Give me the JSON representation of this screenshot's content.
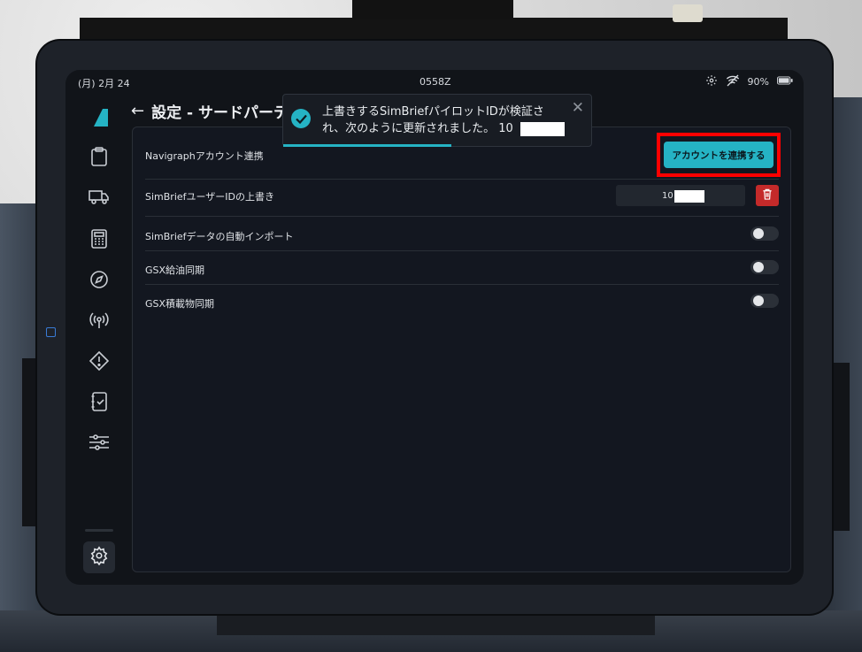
{
  "status_bar": {
    "date": "(月) 2月 24",
    "clock": "0558Z",
    "battery": "90%",
    "icons": [
      "gear-icon",
      "wifi-off-icon",
      "battery-icon"
    ]
  },
  "sidebar": {
    "items": [
      {
        "name": "clipboard-icon"
      },
      {
        "name": "truck-icon"
      },
      {
        "name": "calculator-icon"
      },
      {
        "name": "compass-icon"
      },
      {
        "name": "radio-icon"
      },
      {
        "name": "warning-icon"
      },
      {
        "name": "checklist-icon"
      },
      {
        "name": "sliders-icon"
      }
    ],
    "settings_icon": "gear-icon"
  },
  "header": {
    "back_icon": "←",
    "title": "設定 - サードパーテ"
  },
  "settings": {
    "navigraph": {
      "label": "Navigraphアカウント連携",
      "button_label": "アカウントを連携する"
    },
    "simbrief_override": {
      "label": "SimBriefユーザーIDの上書き",
      "value": "10"
    },
    "simbrief_auto_import": {
      "label": "SimBriefデータの自動インポート",
      "enabled": false
    },
    "gsx_fuel_sync": {
      "label": "GSX給油同期",
      "enabled": false
    },
    "gsx_payload_sync": {
      "label": "GSX積載物同期",
      "enabled": false
    }
  },
  "toast": {
    "message": "上書きするSimBriefパイロットIDが検証され、次のように更新されました。 10",
    "close": "✕"
  },
  "colors": {
    "accent": "#25b3c4",
    "danger": "#c42a2a",
    "highlight": "#ff0000"
  }
}
